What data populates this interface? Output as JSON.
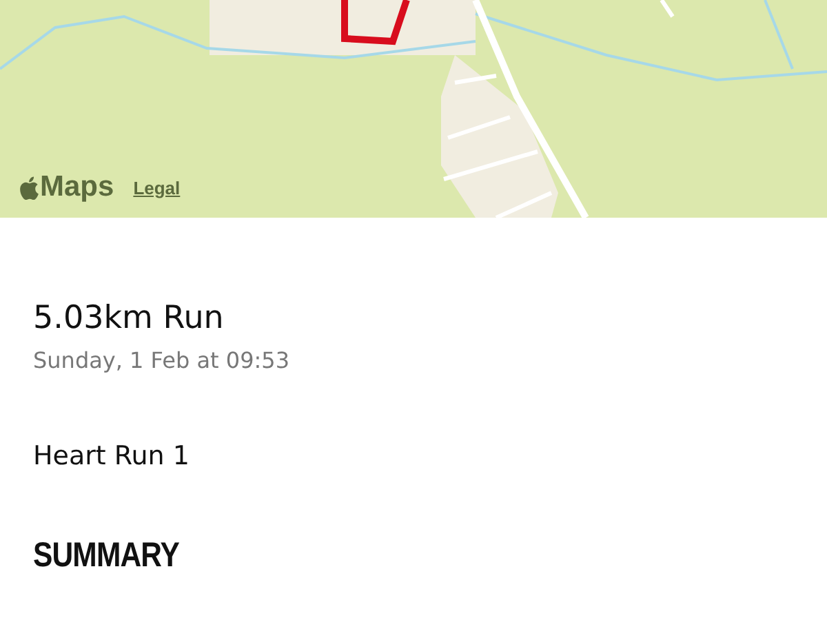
{
  "map": {
    "kind": "picture",
    "brand": "Maps",
    "legal_link": "Legal"
  },
  "activity": {
    "title": "5.03km Run",
    "date": "Sunday, 1 Feb at 09:53",
    "workout_name": "Heart Run 1"
  },
  "section_heading": "SUMMARY"
}
